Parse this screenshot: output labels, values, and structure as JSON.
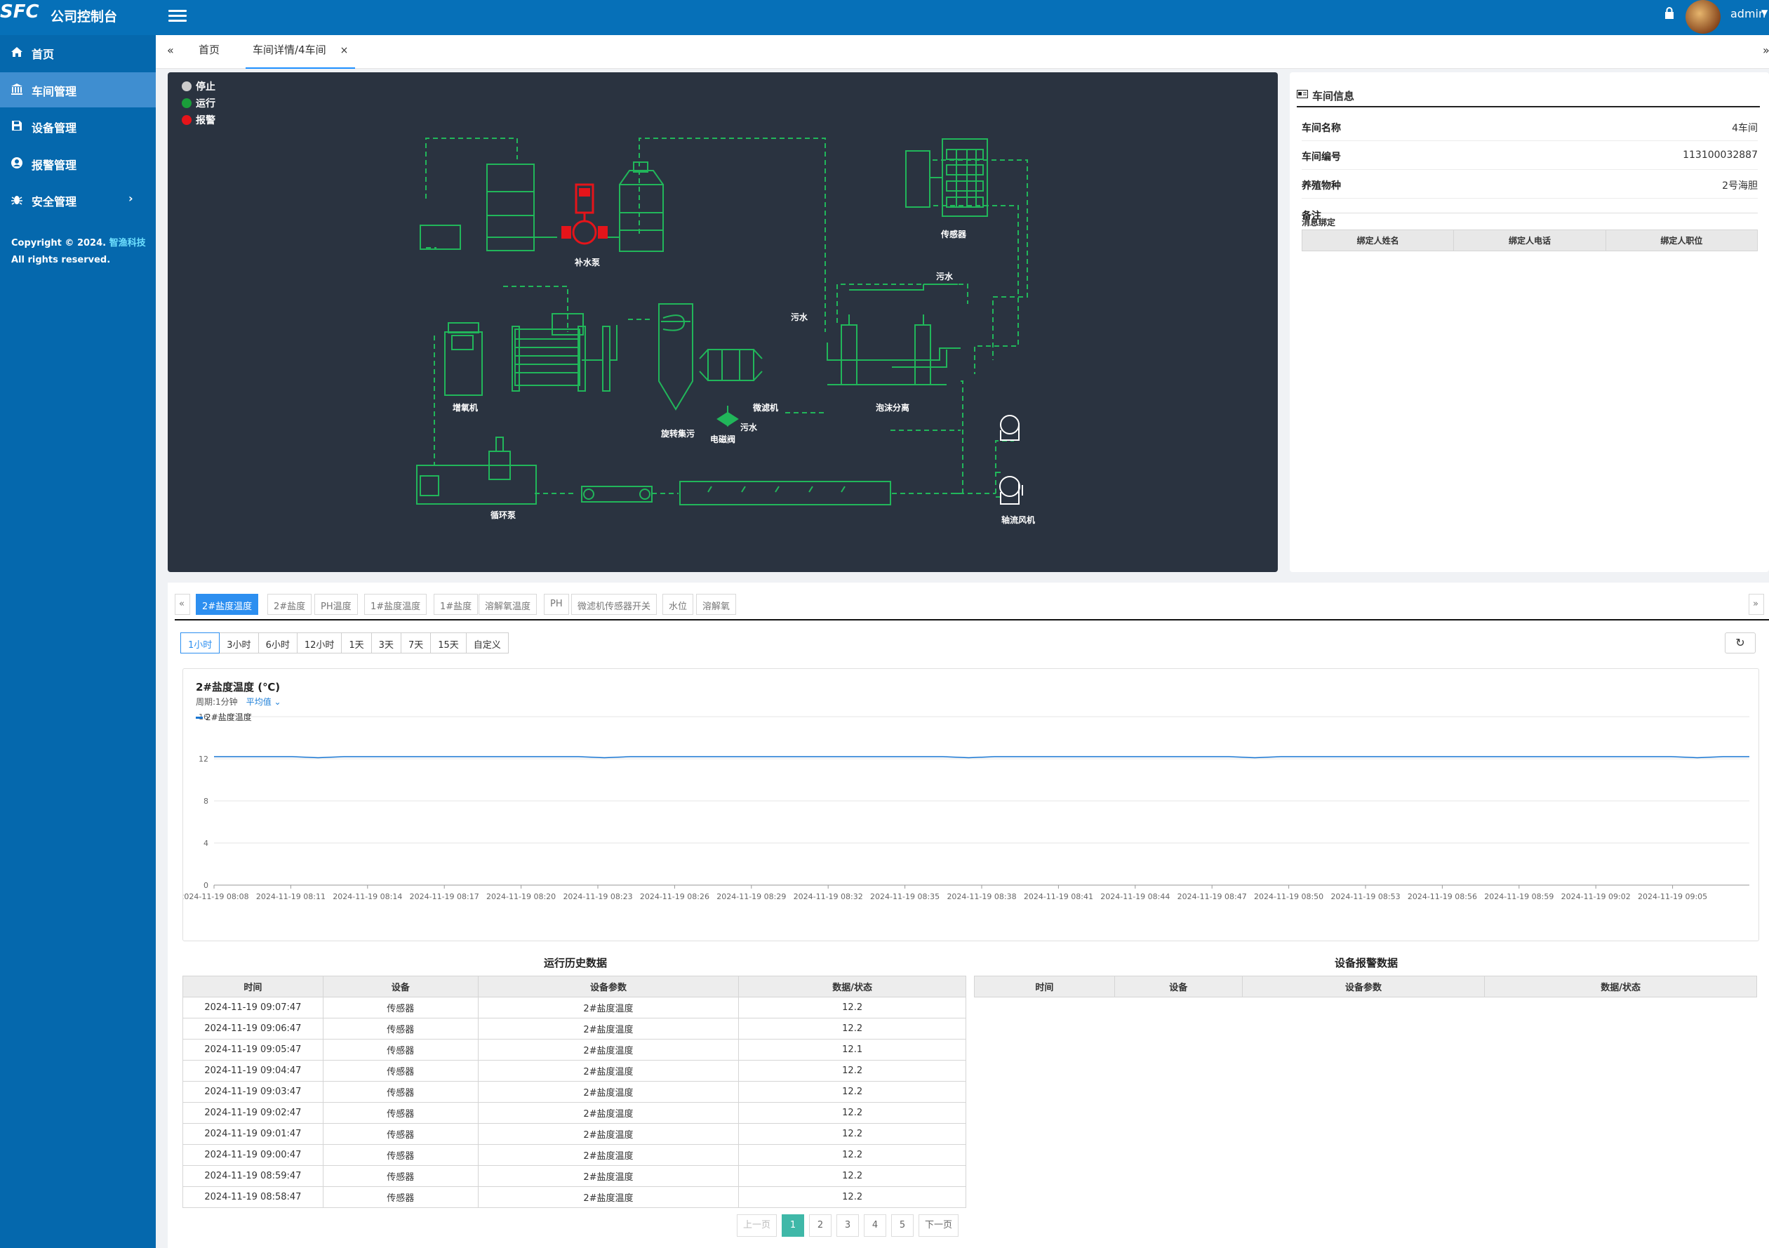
{
  "header": {
    "logo": "SFC",
    "app_title": "公司控制台",
    "user": "admin"
  },
  "sidebar": {
    "items": [
      {
        "label": "首页",
        "icon": "home-icon"
      },
      {
        "label": "车间管理",
        "icon": "bank-icon"
      },
      {
        "label": "设备管理",
        "icon": "save-icon"
      },
      {
        "label": "报警管理",
        "icon": "user-circle-icon"
      },
      {
        "label": "安全管理",
        "icon": "bug-icon"
      }
    ],
    "copyright_prefix": "Copyright © 2024. ",
    "copyright_brand": "智渔科技",
    "copyright_suffix": "All rights reserved."
  },
  "tabs": {
    "home": "首页",
    "current": "车间详情/4车间",
    "left_scroll": "«",
    "right_scroll": "»",
    "close": "×"
  },
  "legend": {
    "stop": "停止",
    "run": "运行",
    "alarm": "报警"
  },
  "colors": {
    "stop": "#cccccc",
    "run": "#1a9e3a",
    "alarm": "#e5141a",
    "accent": "#2d8ff0",
    "pipe": "#21b65a"
  },
  "diagram": {
    "sensor": "传感器",
    "makeup_pump": "补水泵",
    "sewage1": "污水",
    "sewage2": "污水",
    "sewage3": "污水",
    "oxygenator": "增氧机",
    "rotary_collector": "旋转集污",
    "solenoid_valve": "电磁阀",
    "micro_filter": "微滤机",
    "foam_separator": "泡沫分离",
    "circulation_pump": "循环泵",
    "axial_fan": "轴流风机"
  },
  "info": {
    "title": "车间信息",
    "rows": [
      {
        "k": "车间名称",
        "v": "4车间"
      },
      {
        "k": "车间编号",
        "v": "113100032887"
      },
      {
        "k": "养殖物种",
        "v": "2号海胆"
      },
      {
        "k": "备注",
        "v": ""
      }
    ],
    "binding_title": "消息绑定",
    "binding_cols": [
      "绑定人姓名",
      "绑定人电话",
      "绑定人职位"
    ]
  },
  "param_tabs": [
    "2#盐度温度",
    "2#盐度",
    "PH温度",
    "1#盐度温度",
    "1#盐度",
    "溶解氧温度",
    "PH",
    "微滤机传感器开关",
    "水位",
    "溶解氧"
  ],
  "ranges": [
    "1小时",
    "3小时",
    "6小时",
    "12小时",
    "1天",
    "3天",
    "7天",
    "15天",
    "自定义"
  ],
  "chart_data": {
    "type": "line",
    "title": "2#盐度温度 (℃)",
    "period_label": "周期:1分钟",
    "aggregation": "平均值",
    "series": [
      {
        "name": "2#盐度温度",
        "values": [
          12.2,
          12.2,
          12.2,
          12.2,
          12.1,
          12.2,
          12.2,
          12.2,
          12.2,
          12.2,
          12.2,
          12.2,
          12.2,
          12.2,
          12.2,
          12.1,
          12.2,
          12.2,
          12.2,
          12.2,
          12.2,
          12.2,
          12.2,
          12.2,
          12.2,
          12.2,
          12.2,
          12.2,
          12.2,
          12.1,
          12.2,
          12.2,
          12.2,
          12.2,
          12.2,
          12.2,
          12.2,
          12.2,
          12.2,
          12.2,
          12.1,
          12.2,
          12.2,
          12.2,
          12.2,
          12.2,
          12.2,
          12.2,
          12.2,
          12.2,
          12.2,
          12.2,
          12.2,
          12.2,
          12.2,
          12.2,
          12.2,
          12.1,
          12.2,
          12.2
        ]
      }
    ],
    "x_labels": [
      "2024-11-19 08:08",
      "2024-11-19 08:11",
      "2024-11-19 08:14",
      "2024-11-19 08:17",
      "2024-11-19 08:20",
      "2024-11-19 08:23",
      "2024-11-19 08:26",
      "2024-11-19 08:29",
      "2024-11-19 08:32",
      "2024-11-19 08:35",
      "2024-11-19 08:38",
      "2024-11-19 08:41",
      "2024-11-19 08:44",
      "2024-11-19 08:47",
      "2024-11-19 08:50",
      "2024-11-19 08:53",
      "2024-11-19 08:56",
      "2024-11-19 08:59",
      "2024-11-19 09:02",
      "2024-11-19 09:05"
    ],
    "y_ticks": [
      0,
      4,
      8,
      12,
      16
    ],
    "ylim": [
      0,
      16
    ],
    "color": "#1976d2",
    "grid": true,
    "legend_position": "top-left"
  },
  "history": {
    "title": "运行历史数据",
    "cols": [
      "时间",
      "设备",
      "设备参数",
      "数据/状态"
    ],
    "rows": [
      [
        "2024-11-19 09:07:47",
        "传感器",
        "2#盐度温度",
        "12.2"
      ],
      [
        "2024-11-19 09:06:47",
        "传感器",
        "2#盐度温度",
        "12.2"
      ],
      [
        "2024-11-19 09:05:47",
        "传感器",
        "2#盐度温度",
        "12.1"
      ],
      [
        "2024-11-19 09:04:47",
        "传感器",
        "2#盐度温度",
        "12.2"
      ],
      [
        "2024-11-19 09:03:47",
        "传感器",
        "2#盐度温度",
        "12.2"
      ],
      [
        "2024-11-19 09:02:47",
        "传感器",
        "2#盐度温度",
        "12.2"
      ],
      [
        "2024-11-19 09:01:47",
        "传感器",
        "2#盐度温度",
        "12.2"
      ],
      [
        "2024-11-19 09:00:47",
        "传感器",
        "2#盐度温度",
        "12.2"
      ],
      [
        "2024-11-19 08:59:47",
        "传感器",
        "2#盐度温度",
        "12.2"
      ],
      [
        "2024-11-19 08:58:47",
        "传感器",
        "2#盐度温度",
        "12.2"
      ]
    ]
  },
  "alarm": {
    "title": "设备报警数据",
    "cols": [
      "时间",
      "设备",
      "设备参数",
      "数据/状态"
    ]
  },
  "pager": {
    "prev": "上一页",
    "next": "下一页",
    "pages": [
      "1",
      "2",
      "3",
      "4",
      "5"
    ],
    "current": "1"
  }
}
